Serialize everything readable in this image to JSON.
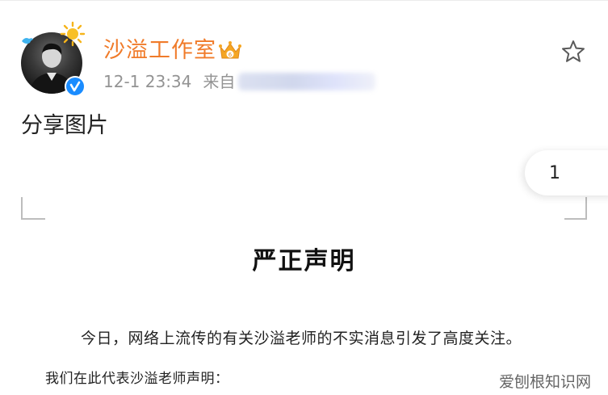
{
  "post": {
    "author_name": "沙溢工作室",
    "timestamp": "12-1 23:34",
    "source_prefix": "来自",
    "text": "分享图片",
    "image_page_count": "1"
  },
  "document": {
    "title": "严正声明",
    "line1": "今日，网络上流传的有关沙溢老师的不实消息引发了高度关注。",
    "line2": "我们在此代表沙溢老师声明："
  },
  "watermark": "爱刨根知识网",
  "icons": {
    "favorite": "star-outline-icon",
    "verified": "verified-badge-icon",
    "crown": "vip-crown-icon",
    "sun": "sun-icon",
    "bird": "bird-icon"
  },
  "colors": {
    "author_name": "#f07b2a",
    "meta": "#939393",
    "verified": "#1a8cff"
  }
}
